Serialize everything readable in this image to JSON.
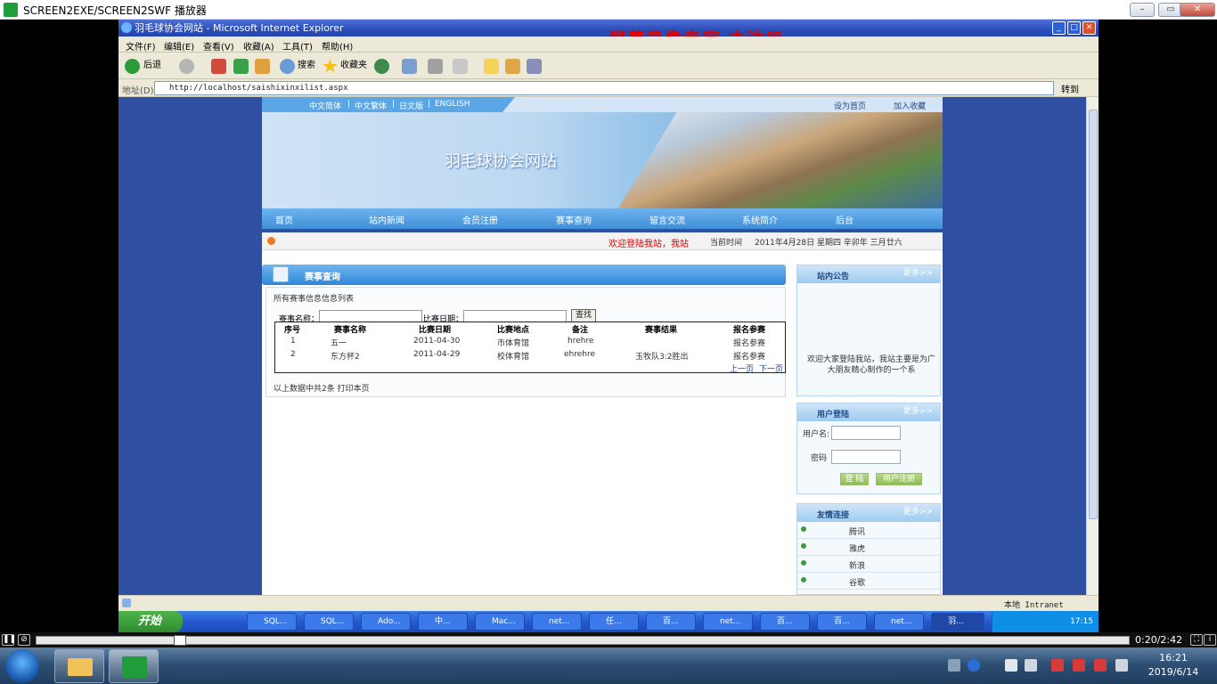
{
  "player": {
    "title": "SCREEN2EXE/SCREEN2SWF 播放器",
    "time": "0:20/2:42"
  },
  "ie": {
    "title": "羽毛球协会网站 - Microsoft Internet Explorer",
    "watermark": "屏幕录像专家  未注册",
    "menu": [
      "文件(F)",
      "编辑(E)",
      "查看(V)",
      "收藏(A)",
      "工具(T)",
      "帮助(H)"
    ],
    "toolbar": {
      "back": "后退",
      "search": "搜索",
      "favorites": "收藏夹"
    },
    "address_label": "地址(D)",
    "address": "http://localhost/saishixinxilist.aspx",
    "go": "转到",
    "status_zone": "本地 Intranet"
  },
  "site": {
    "langs": [
      "中文简体",
      "中文繁体",
      "日文版",
      "ENGLISH"
    ],
    "top_right": [
      "设为首页",
      "加入收藏"
    ],
    "site_title": "羽毛球协会网站",
    "nav": [
      "首页",
      "站内新闻",
      "会员注册",
      "赛事查询",
      "留言交流",
      "系统简介",
      "后台"
    ],
    "welcome": "欢迎登陆我站，我站",
    "date_label": "当前时间",
    "date": "2011年4月28日 星期四 辛卯年 三月廿六",
    "panel_title": "赛事查询",
    "list_caption": "所有赛事信息信息列表",
    "search": {
      "name_label": "赛事名称：",
      "date_label": "比赛日期：",
      "button": "查找"
    },
    "table": {
      "headers": [
        "序号",
        "赛事名称",
        "比赛日期",
        "比赛地点",
        "备注",
        "赛事结果",
        "报名参赛"
      ],
      "rows": [
        [
          "1",
          "五一",
          "2011-04-30",
          "市体育馆",
          "hrehre",
          "",
          "报名参赛"
        ],
        [
          "2",
          "东方杯2",
          "2011-04-29",
          "校体育馆",
          "ehrehre",
          "玉牧队3:2胜出",
          "报名参赛"
        ]
      ],
      "prev": "上一页",
      "next": "下一页"
    },
    "list_footer": "以上数据中共2条  打印本页",
    "notice": {
      "title": "站内公告",
      "more": "更多>>",
      "text": "欢迎大家登陆我站，我站主要是为广大朋友精心制作的一个系"
    },
    "login": {
      "title": "用户登陆",
      "more": "更多>>",
      "user_label": "用户名:",
      "pass_label": "密码",
      "login_btn": "登 陆",
      "register_btn": "用户注册"
    },
    "links": {
      "title": "友情连接",
      "more": "更多>>",
      "items": [
        "腾讯",
        "雅虎",
        "新浪",
        "谷歌"
      ]
    }
  },
  "xp_taskbar": {
    "start": "开始",
    "tasks": [
      "SQL...",
      "SQL...",
      "Ado...",
      "中...",
      "Mac...",
      "net...",
      "任...",
      "百...",
      "net...",
      "百...",
      "百...",
      "net...",
      "羽..."
    ],
    "time": "17:15"
  },
  "win7": {
    "time": "16:21",
    "date": "2019/6/14"
  }
}
